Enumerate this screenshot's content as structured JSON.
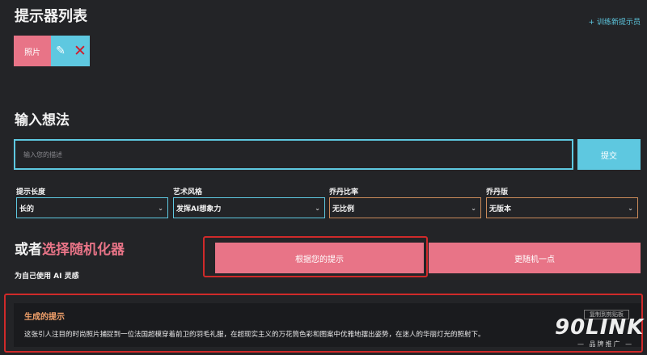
{
  "header": {
    "title": "提示器列表",
    "train_link": "+ 训练新提示员"
  },
  "prompter_chip": {
    "label": "照片",
    "edit_icon": "pencil-icon",
    "delete_icon": "close-icon"
  },
  "input_section": {
    "title": "输入想法",
    "placeholder": "输入您的描述",
    "submit_label": "提交"
  },
  "selects": [
    {
      "label": "提示长度",
      "value": "长的",
      "accent": "#5ec8e0"
    },
    {
      "label": "艺术风格",
      "value": "发挥AI想象力",
      "accent": "#5ec8e0"
    },
    {
      "label": "乔丹比率",
      "value": "无比例",
      "accent": "#c98a5a"
    },
    {
      "label": "乔丹版",
      "value": "无版本",
      "accent": "#c98a5a"
    }
  ],
  "randomizer": {
    "title_prefix": "或者",
    "title_highlight": "选择随机化器",
    "subtitle": "为自己使用 AI 灵感",
    "based_button": "根据您的提示",
    "more_random_button": "更随机一点"
  },
  "generated": {
    "title": "生成的提示",
    "copy_button": "复制到剪贴板",
    "text": "这张引人注目的时尚照片捕捉到一位法国超模穿着前卫的羽毛礼服，在超现实主义的万花筒色彩和图案中优雅地摆出姿势，在迷人的华丽灯光的照射下。"
  },
  "watermark": {
    "main": "90LINK",
    "sub": "— 品牌推广 —"
  },
  "colors": {
    "background": "#232427",
    "accent_cyan": "#5ec8e0",
    "accent_pink": "#e87487",
    "accent_orange": "#c98a5a",
    "highlight_red": "#cf2a2a"
  }
}
